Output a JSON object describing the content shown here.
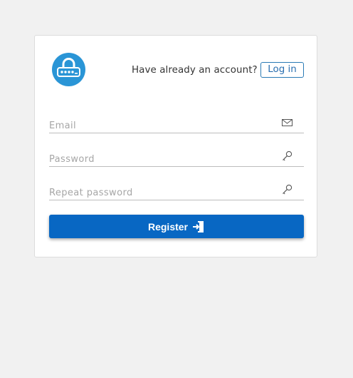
{
  "header": {
    "logo_icon": "padlock-password-icon",
    "login_prompt": "Have already an account?",
    "login_button_label": "Log in"
  },
  "form": {
    "email": {
      "placeholder": "Email",
      "value": "",
      "icon": "envelope-icon"
    },
    "password": {
      "placeholder": "Password",
      "value": "",
      "icon": "key-icon"
    },
    "repeat_password": {
      "placeholder": "Repeat password",
      "value": "",
      "icon": "key-icon"
    },
    "register_label": "Register",
    "register_icon": "sign-in-icon"
  },
  "colors": {
    "accent": "#0867c3",
    "logo_bg": "#2a95d6",
    "page_bg": "#f1f1f1"
  }
}
